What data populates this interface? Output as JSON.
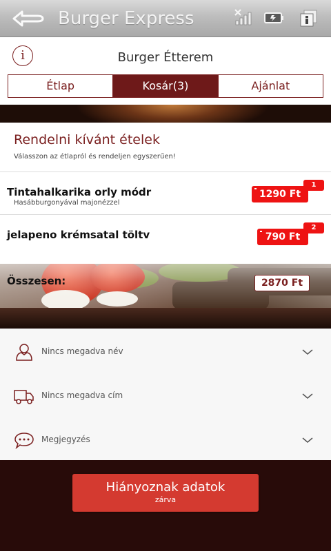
{
  "app": {
    "title": "Burger Express"
  },
  "icons": {
    "back": "back-arrow-icon",
    "signal": "signal-off-icon",
    "battery": "battery-icon",
    "overflow": "info-menu-icon",
    "info": "info-icon",
    "user": "user-icon",
    "truck": "truck-icon",
    "comment": "comment-icon",
    "chevron": "chevron-down-icon"
  },
  "header": {
    "info_symbol": "i",
    "restaurant": "Burger Étterem",
    "tabs": [
      {
        "label": "Étlap",
        "active": false
      },
      {
        "label": "Kosár(3)",
        "active": true
      },
      {
        "label": "Ajánlat",
        "active": false
      }
    ]
  },
  "order": {
    "title": "Rendelni kívánt ételek",
    "subtitle": "Válasszon az étlapról és rendeljen egyszerűen!",
    "items": [
      {
        "name": "Tintahalkarika orly módr",
        "description": "Hasábburgonyával majonézzel",
        "price": "1290 Ft",
        "quantity": "1"
      },
      {
        "name": "jelapeno krémsatal töltv",
        "description": "",
        "price": "790 Ft",
        "quantity": "2"
      }
    ],
    "total_label": "Összesen:",
    "total": "2870 Ft"
  },
  "form": {
    "fields": [
      {
        "label": "Nincs megadva név"
      },
      {
        "label": "Nincs megadva cím"
      },
      {
        "label": "Megjegyzés"
      }
    ]
  },
  "submit": {
    "label": "Hiányoznak adatok",
    "status": "zárva"
  },
  "colors": {
    "brand": "#6e1919",
    "price_badge": "#ee1313",
    "submit": "#d43a30",
    "footer": "#280b09"
  }
}
